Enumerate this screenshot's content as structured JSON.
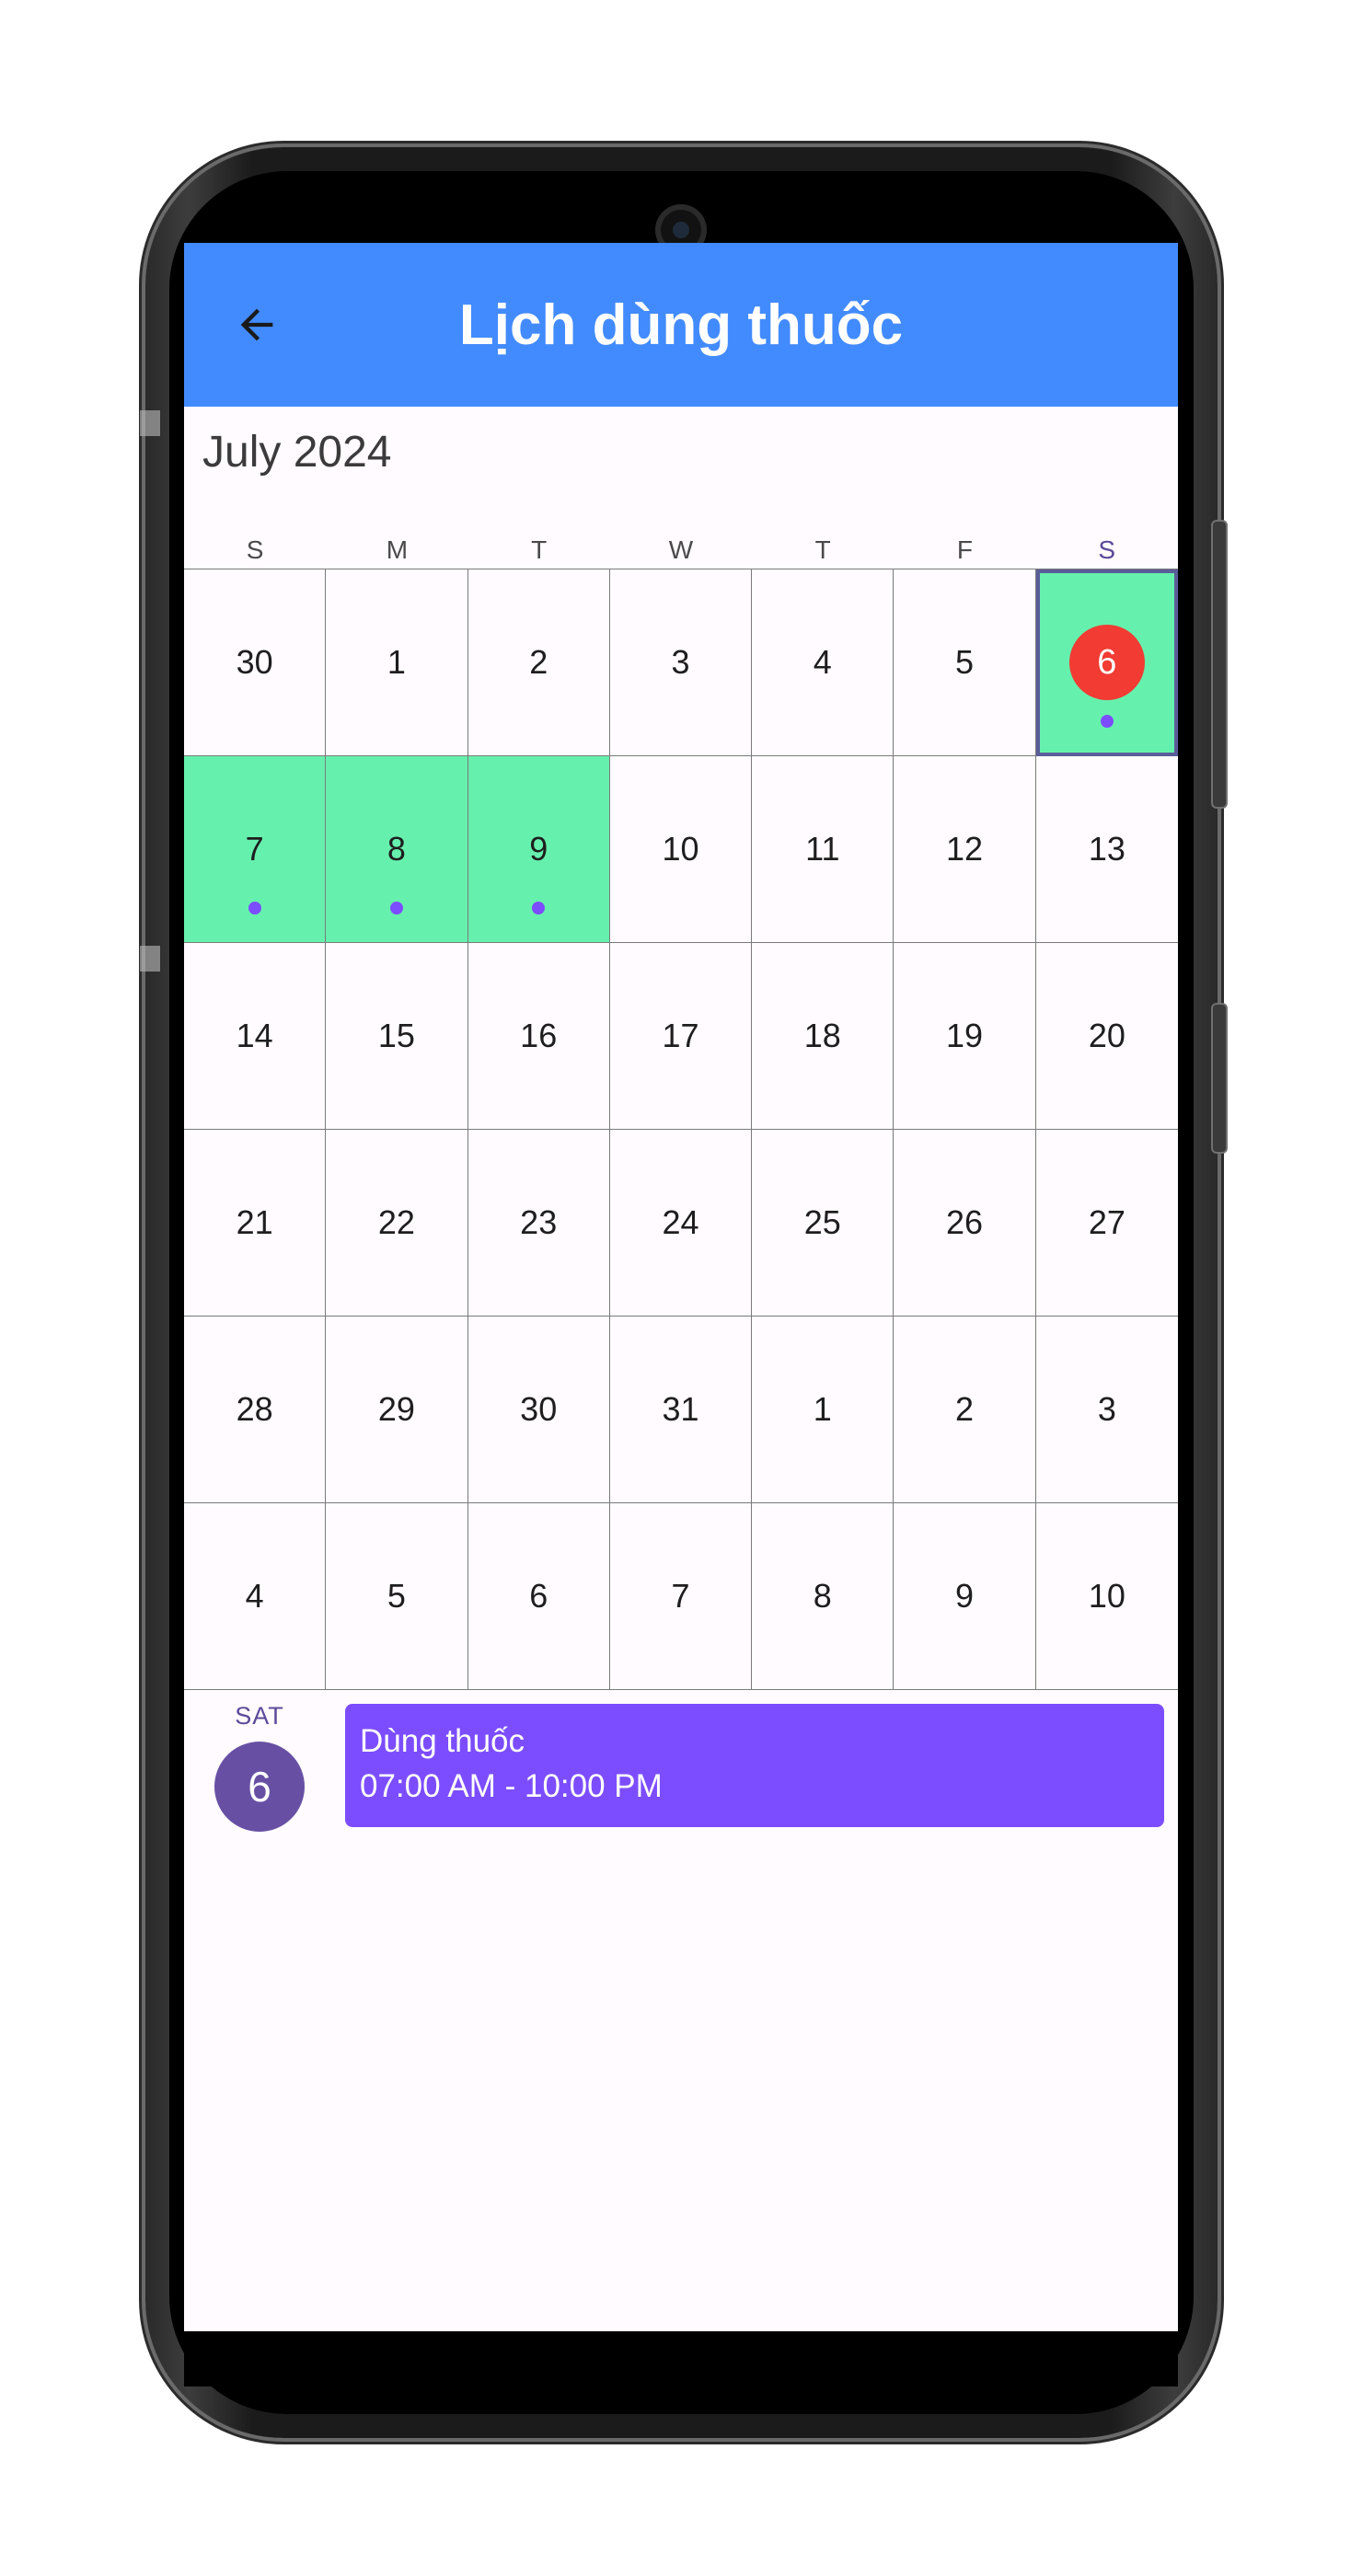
{
  "appbar": {
    "title": "Lịch dùng thuốc",
    "back_icon": "arrow-left-icon",
    "color": "#428bfe"
  },
  "calendar": {
    "month_label": "July 2024",
    "weekdays": [
      "S",
      "M",
      "T",
      "W",
      "T",
      "F",
      "S"
    ],
    "highlight_color": "#66f0ad",
    "today_color": "#f13b33",
    "event_dot_color": "#7c4dff",
    "weeks": [
      [
        "30",
        "1",
        "2",
        "3",
        "4",
        "5",
        "6"
      ],
      [
        "7",
        "8",
        "9",
        "10",
        "11",
        "12",
        "13"
      ],
      [
        "14",
        "15",
        "16",
        "17",
        "18",
        "19",
        "20"
      ],
      [
        "21",
        "22",
        "23",
        "24",
        "25",
        "26",
        "27"
      ],
      [
        "28",
        "29",
        "30",
        "31",
        "1",
        "2",
        "3"
      ],
      [
        "4",
        "5",
        "6",
        "7",
        "8",
        "9",
        "10"
      ]
    ],
    "highlighted_cells": [
      [
        0,
        6
      ],
      [
        1,
        0
      ],
      [
        1,
        1
      ],
      [
        1,
        2
      ]
    ],
    "today_cell": [
      0,
      6
    ],
    "selected_cell": [
      0,
      6
    ],
    "dot_cells": [
      [
        0,
        6
      ],
      [
        1,
        0
      ],
      [
        1,
        1
      ],
      [
        1,
        2
      ]
    ]
  },
  "agenda": {
    "day_of_week": "SAT",
    "date": "6",
    "events": [
      {
        "title": "Dùng thuốc",
        "time": "07:00 AM - 10:00 PM",
        "color": "#7c4dff"
      }
    ]
  }
}
